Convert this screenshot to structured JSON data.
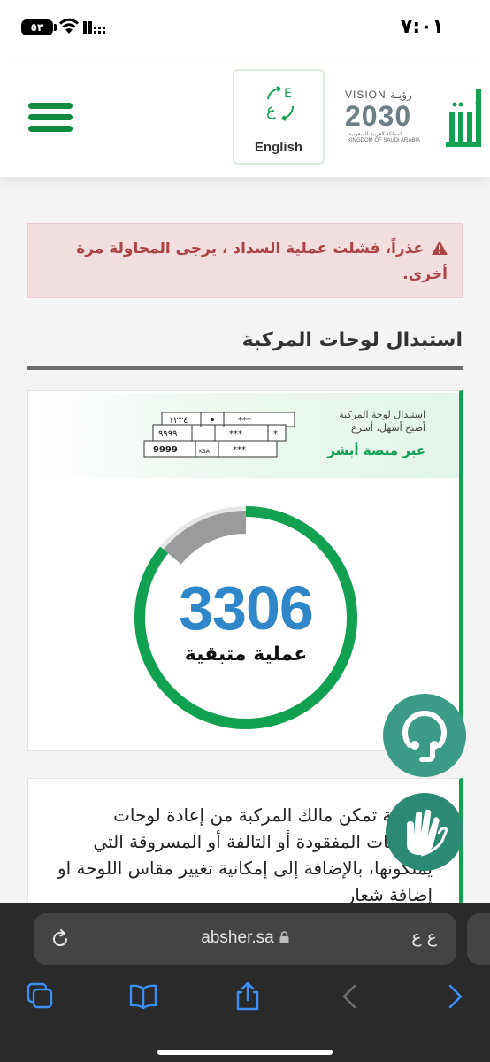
{
  "status_bar": {
    "time": "٧:٠١",
    "battery": "٥٣"
  },
  "header": {
    "language_button_label": "English",
    "vision_title": "VISION رؤيـة",
    "vision_year": "2030",
    "vision_sub_ar": "المملكة العربية السعودية",
    "vision_sub_en": "KINGDOM OF SAUDI ARABIA"
  },
  "alert": {
    "message": "عذراً، فشلت عملية السداد ، يرجى المحاولة مرة أخرى."
  },
  "section": {
    "title": "استبدال لوحات المركبة"
  },
  "banner": {
    "line1": "استبدال لوحة المركبة",
    "line2": "أصبح أسهل، أسرع",
    "line3": "عبر منصة أبشر",
    "plate_top": "١٢٣٤ | ● | ***",
    "plate_mid": "٩٩٩٩ | *** | *",
    "plate_bottom": "9999 | KSA | ***"
  },
  "counter": {
    "value": "3306",
    "label": "عملية متبقية",
    "remaining_fraction": 0.86
  },
  "description": {
    "text": "الخدمة تمكن مالك المركبة من إعادة لوحات المركبات المفقودة أو التالفة أو المسروقة التي يملكونها، بالإضافة إلى إمكانية تغيير مقاس اللوحة او إضافة شعار"
  },
  "browser": {
    "url": "absher.sa",
    "reader_label": "ع ع"
  },
  "colors": {
    "brand_green": "#0e8a3e",
    "gauge_green": "#12a150",
    "counter_blue": "#2f86c8",
    "alert_bg": "#f2dede",
    "alert_text": "#a94442"
  }
}
